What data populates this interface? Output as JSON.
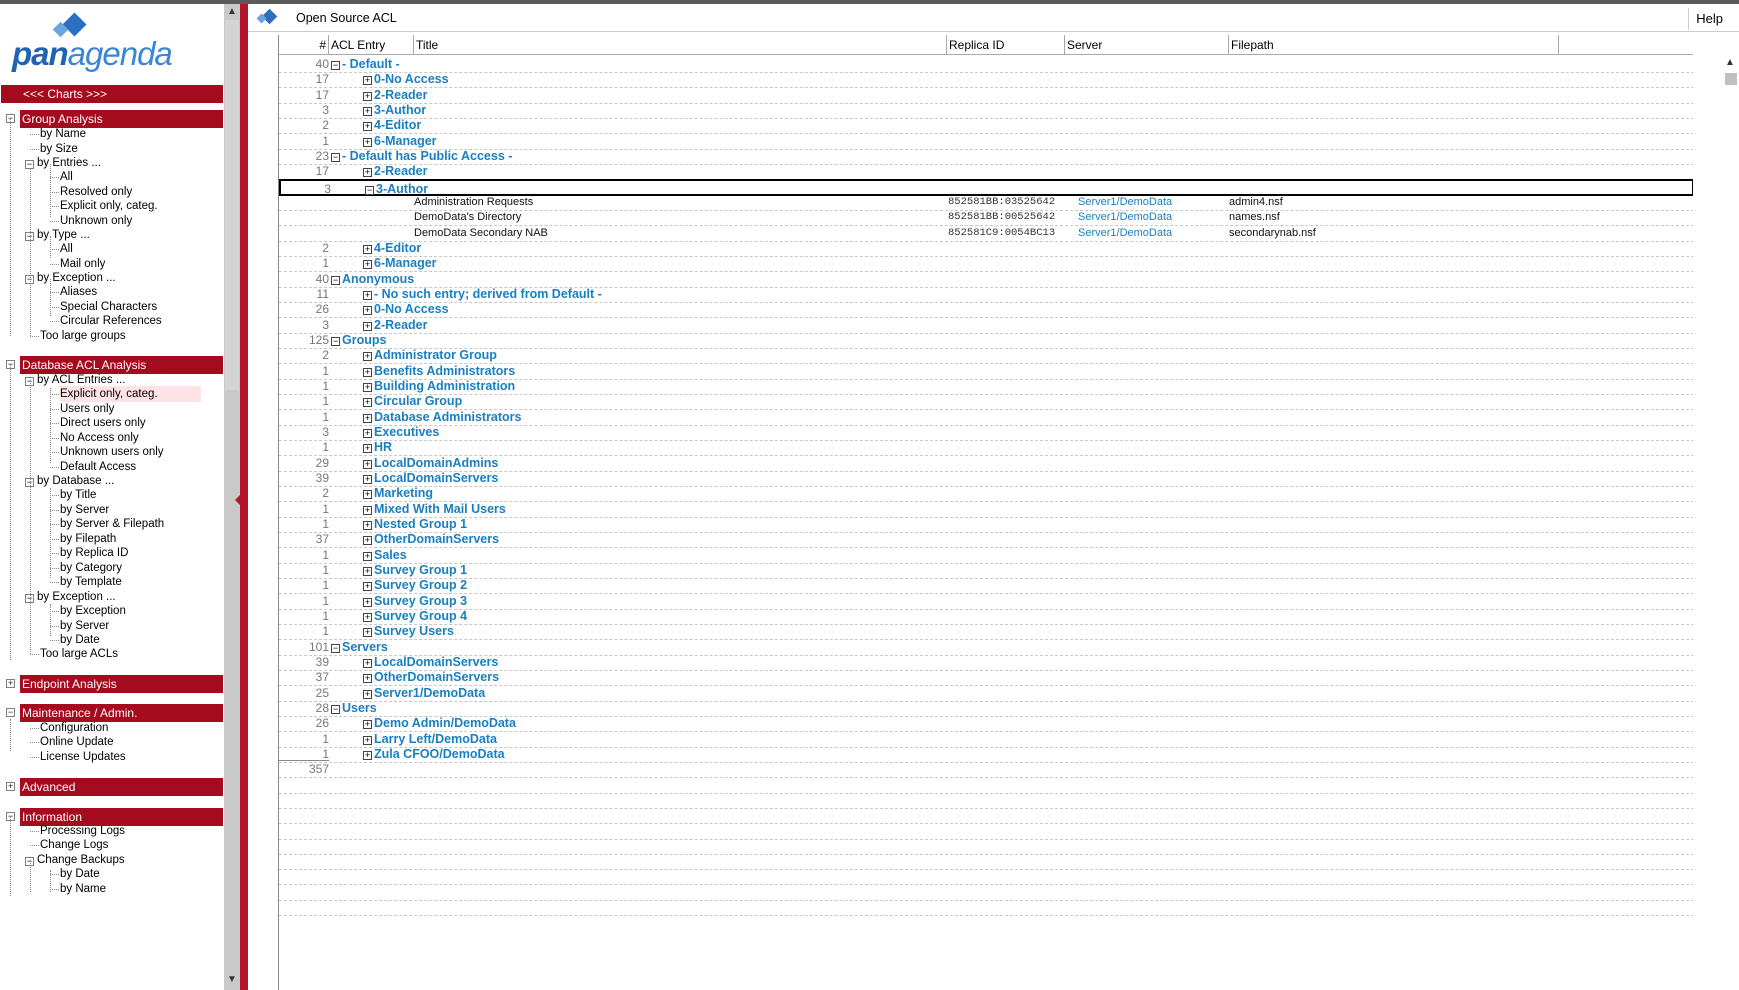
{
  "logo": {
    "pan": "pan",
    "agenda": "agenda"
  },
  "sidebar": {
    "charts_label": "<<< Charts >>>",
    "sections": [
      {
        "label": "Group Analysis",
        "expanded": true,
        "toggle": "−"
      },
      {
        "label": "Database ACL Analysis",
        "expanded": true,
        "toggle": "−"
      },
      {
        "label": "Endpoint Analysis",
        "expanded": false,
        "toggle": "+"
      },
      {
        "label": "Maintenance / Admin.",
        "expanded": true,
        "toggle": "−"
      },
      {
        "label": "Advanced",
        "expanded": false,
        "toggle": "+"
      },
      {
        "label": "Information",
        "expanded": true,
        "toggle": "−"
      }
    ],
    "items": {
      "g_by_name": "by Name",
      "g_by_size": "by Size",
      "g_by_entries": "by Entries ...",
      "g_entries_all": "All",
      "g_entries_resolved": "Resolved only",
      "g_entries_explicit": "Explicit only, categ.",
      "g_entries_unknown": "Unknown only",
      "g_by_type": "by Type ...",
      "g_type_all": "All",
      "g_type_mail": "Mail only",
      "g_by_exception": "by Exception ...",
      "g_exc_aliases": "Aliases",
      "g_exc_special": "Special Characters",
      "g_exc_circular": "Circular References",
      "g_too_large": "Too large groups",
      "d_by_acl": "by ACL Entries ...",
      "d_acl_explicit": "Explicit only, categ.",
      "d_acl_users": "Users only",
      "d_acl_direct": "Direct users only",
      "d_acl_noaccess": "No Access only",
      "d_acl_unknown": "Unknown users only",
      "d_acl_default": "Default Access",
      "d_by_database": "by Database ...",
      "d_db_title": "by Title",
      "d_db_server": "by Server",
      "d_db_server_fp": "by Server & Filepath",
      "d_db_filepath": "by Filepath",
      "d_db_replica": "by Replica ID",
      "d_db_category": "by Category",
      "d_db_template": "by Template",
      "d_by_exception": "by Exception ...",
      "d_exc_exception": "by Exception",
      "d_exc_server": "by Server",
      "d_exc_date": "by Date",
      "d_too_large": "Too large ACLs",
      "m_config": "Configuration",
      "m_online": "Online Update",
      "m_license": "License Updates",
      "i_processing": "Processing Logs",
      "i_change": "Change Logs",
      "i_backups": "Change Backups",
      "i_bk_date": "by Date",
      "i_bk_name": "by Name"
    }
  },
  "header": {
    "title": "Open Source ACL",
    "help": "Help"
  },
  "columns": {
    "num": "#",
    "acl_entry": "ACL Entry",
    "title": "Title",
    "replica_id": "Replica ID",
    "server": "Server",
    "filepath": "Filepath"
  },
  "rows": [
    {
      "count": "40",
      "level": 0,
      "toggle": "−",
      "label": "- Default -"
    },
    {
      "count": "17",
      "level": 1,
      "toggle": "+",
      "label": "0-No Access"
    },
    {
      "count": "17",
      "level": 1,
      "toggle": "+",
      "label": "2-Reader"
    },
    {
      "count": "3",
      "level": 1,
      "toggle": "+",
      "label": "3-Author"
    },
    {
      "count": "2",
      "level": 1,
      "toggle": "+",
      "label": "4-Editor"
    },
    {
      "count": "1",
      "level": 1,
      "toggle": "+",
      "label": "6-Manager"
    },
    {
      "count": "23",
      "level": 0,
      "toggle": "−",
      "label": "- Default has Public Access -"
    },
    {
      "count": "17",
      "level": 1,
      "toggle": "+",
      "label": "2-Reader"
    },
    {
      "count": "3",
      "level": 1,
      "toggle": "−",
      "label": "3-Author",
      "selected": true
    },
    {
      "doc": true,
      "title": "Administration Requests",
      "replica": "852581BB:03525642",
      "server": "Server1/DemoData",
      "filepath": "admin4.nsf"
    },
    {
      "doc": true,
      "title": "DemoData's Directory",
      "replica": "852581BB:00525642",
      "server": "Server1/DemoData",
      "filepath": "names.nsf"
    },
    {
      "doc": true,
      "title": "DemoData Secondary NAB",
      "replica": "852581C9:0054BC13",
      "server": "Server1/DemoData",
      "filepath": "secondarynab.nsf"
    },
    {
      "count": "2",
      "level": 1,
      "toggle": "+",
      "label": "4-Editor"
    },
    {
      "count": "1",
      "level": 1,
      "toggle": "+",
      "label": "6-Manager"
    },
    {
      "count": "40",
      "level": 0,
      "toggle": "−",
      "label": "Anonymous"
    },
    {
      "count": "11",
      "level": 1,
      "toggle": "+",
      "label": "- No such entry; derived from Default -"
    },
    {
      "count": "26",
      "level": 1,
      "toggle": "+",
      "label": "0-No Access"
    },
    {
      "count": "3",
      "level": 1,
      "toggle": "+",
      "label": "2-Reader"
    },
    {
      "count": "125",
      "level": 0,
      "toggle": "−",
      "label": "Groups"
    },
    {
      "count": "2",
      "level": 1,
      "toggle": "+",
      "label": "Administrator Group"
    },
    {
      "count": "1",
      "level": 1,
      "toggle": "+",
      "label": "Benefits Administrators"
    },
    {
      "count": "1",
      "level": 1,
      "toggle": "+",
      "label": "Building Administration"
    },
    {
      "count": "1",
      "level": 1,
      "toggle": "+",
      "label": "Circular Group"
    },
    {
      "count": "1",
      "level": 1,
      "toggle": "+",
      "label": "Database Administrators"
    },
    {
      "count": "3",
      "level": 1,
      "toggle": "+",
      "label": "Executives"
    },
    {
      "count": "1",
      "level": 1,
      "toggle": "+",
      "label": "HR"
    },
    {
      "count": "29",
      "level": 1,
      "toggle": "+",
      "label": "LocalDomainAdmins"
    },
    {
      "count": "39",
      "level": 1,
      "toggle": "+",
      "label": "LocalDomainServers"
    },
    {
      "count": "2",
      "level": 1,
      "toggle": "+",
      "label": "Marketing"
    },
    {
      "count": "1",
      "level": 1,
      "toggle": "+",
      "label": "Mixed With Mail Users"
    },
    {
      "count": "1",
      "level": 1,
      "toggle": "+",
      "label": "Nested Group 1"
    },
    {
      "count": "37",
      "level": 1,
      "toggle": "+",
      "label": "OtherDomainServers"
    },
    {
      "count": "1",
      "level": 1,
      "toggle": "+",
      "label": "Sales"
    },
    {
      "count": "1",
      "level": 1,
      "toggle": "+",
      "label": "Survey Group 1"
    },
    {
      "count": "1",
      "level": 1,
      "toggle": "+",
      "label": "Survey Group 2"
    },
    {
      "count": "1",
      "level": 1,
      "toggle": "+",
      "label": "Survey Group 3"
    },
    {
      "count": "1",
      "level": 1,
      "toggle": "+",
      "label": "Survey Group 4"
    },
    {
      "count": "1",
      "level": 1,
      "toggle": "+",
      "label": "Survey Users"
    },
    {
      "count": "101",
      "level": 0,
      "toggle": "−",
      "label": "Servers"
    },
    {
      "count": "39",
      "level": 1,
      "toggle": "+",
      "label": "LocalDomainServers"
    },
    {
      "count": "37",
      "level": 1,
      "toggle": "+",
      "label": "OtherDomainServers"
    },
    {
      "count": "25",
      "level": 1,
      "toggle": "+",
      "label": "Server1/DemoData"
    },
    {
      "count": "28",
      "level": 0,
      "toggle": "−",
      "label": "Users"
    },
    {
      "count": "26",
      "level": 1,
      "toggle": "+",
      "label": "Demo Admin/DemoData"
    },
    {
      "count": "1",
      "level": 1,
      "toggle": "+",
      "label": "Larry Left/DemoData"
    },
    {
      "count": "1",
      "level": 1,
      "toggle": "+",
      "label": "Zula CFOO/DemoData"
    },
    {
      "total": true,
      "count": "357"
    }
  ],
  "colors": {
    "accent": "#a50b1e",
    "link": "#1a7fc0",
    "selected_nav": "#fde3e6"
  }
}
